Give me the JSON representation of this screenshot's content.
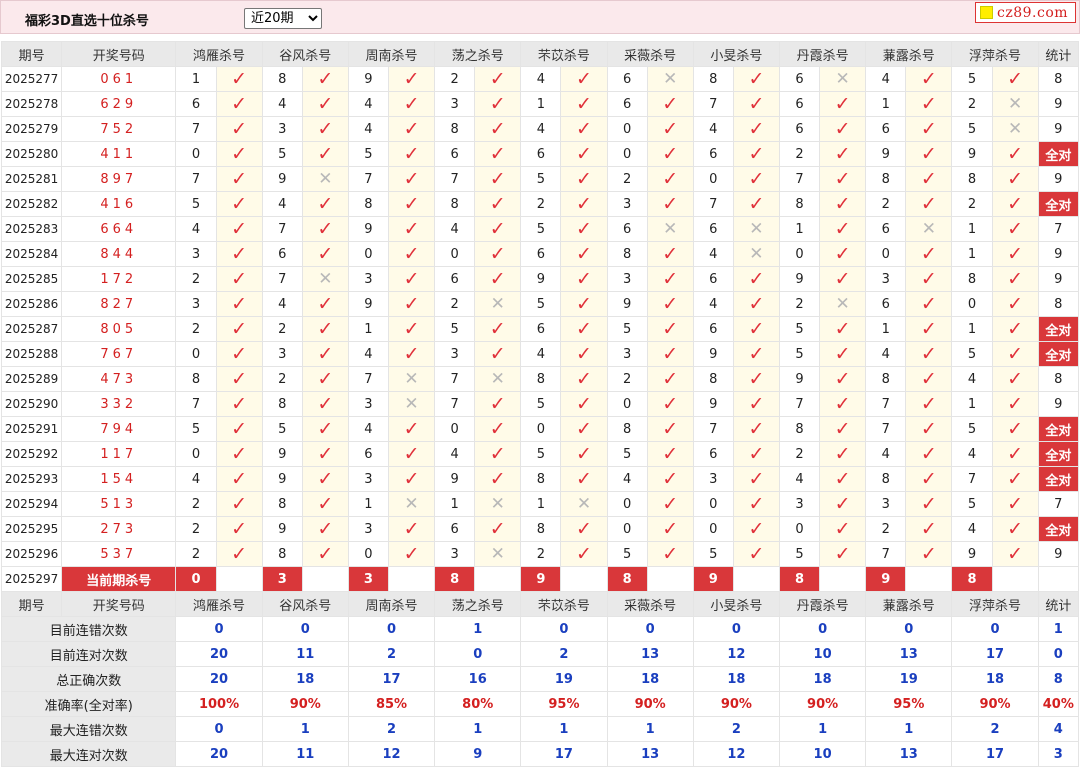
{
  "header": {
    "title": "福彩3D直选十位杀号",
    "period_select": "近20期",
    "logo_text": "cz89.com"
  },
  "columns": {
    "issue": "期号",
    "draw": "开奖号码",
    "experts": [
      "鸿雁杀号",
      "谷风杀号",
      "周南杀号",
      "荡之杀号",
      "芣苡杀号",
      "采薇杀号",
      "小旻杀号",
      "丹霞杀号",
      "蒹露杀号",
      "浮萍杀号"
    ],
    "stat": "统计"
  },
  "all_correct_label": "全对",
  "icons": {
    "hit": "check-mark-icon",
    "miss": "cross-mark-icon",
    "hit_color": "#e0303a",
    "miss_color": "#b8b8b8",
    "badge_color": "#d9373a"
  },
  "rows": [
    {
      "issue": "2025277",
      "draw": "061",
      "kills": [
        "1",
        "8",
        "9",
        "2",
        "4",
        "6",
        "8",
        "6",
        "4",
        "5"
      ],
      "hits": [
        1,
        1,
        1,
        1,
        1,
        0,
        1,
        0,
        1,
        1
      ],
      "stat": "8"
    },
    {
      "issue": "2025278",
      "draw": "629",
      "kills": [
        "6",
        "4",
        "4",
        "3",
        "1",
        "6",
        "7",
        "6",
        "1",
        "2"
      ],
      "hits": [
        1,
        1,
        1,
        1,
        1,
        1,
        1,
        1,
        1,
        0
      ],
      "stat": "9"
    },
    {
      "issue": "2025279",
      "draw": "752",
      "kills": [
        "7",
        "3",
        "4",
        "8",
        "4",
        "0",
        "4",
        "6",
        "6",
        "5"
      ],
      "hits": [
        1,
        1,
        1,
        1,
        1,
        1,
        1,
        1,
        1,
        0
      ],
      "stat": "9"
    },
    {
      "issue": "2025280",
      "draw": "411",
      "kills": [
        "0",
        "5",
        "5",
        "6",
        "6",
        "0",
        "6",
        "2",
        "9",
        "9"
      ],
      "hits": [
        1,
        1,
        1,
        1,
        1,
        1,
        1,
        1,
        1,
        1
      ],
      "stat": "全对"
    },
    {
      "issue": "2025281",
      "draw": "897",
      "kills": [
        "7",
        "9",
        "7",
        "7",
        "5",
        "2",
        "0",
        "7",
        "8",
        "8"
      ],
      "hits": [
        1,
        0,
        1,
        1,
        1,
        1,
        1,
        1,
        1,
        1
      ],
      "stat": "9"
    },
    {
      "issue": "2025282",
      "draw": "416",
      "kills": [
        "5",
        "4",
        "8",
        "8",
        "2",
        "3",
        "7",
        "8",
        "2",
        "2"
      ],
      "hits": [
        1,
        1,
        1,
        1,
        1,
        1,
        1,
        1,
        1,
        1
      ],
      "stat": "全对"
    },
    {
      "issue": "2025283",
      "draw": "664",
      "kills": [
        "4",
        "7",
        "9",
        "4",
        "5",
        "6",
        "6",
        "1",
        "6",
        "1"
      ],
      "hits": [
        1,
        1,
        1,
        1,
        1,
        0,
        0,
        1,
        0,
        1
      ],
      "stat": "7"
    },
    {
      "issue": "2025284",
      "draw": "844",
      "kills": [
        "3",
        "6",
        "0",
        "0",
        "6",
        "8",
        "4",
        "0",
        "0",
        "1"
      ],
      "hits": [
        1,
        1,
        1,
        1,
        1,
        1,
        0,
        1,
        1,
        1
      ],
      "stat": "9"
    },
    {
      "issue": "2025285",
      "draw": "172",
      "kills": [
        "2",
        "7",
        "3",
        "6",
        "9",
        "3",
        "6",
        "9",
        "3",
        "8"
      ],
      "hits": [
        1,
        0,
        1,
        1,
        1,
        1,
        1,
        1,
        1,
        1
      ],
      "stat": "9"
    },
    {
      "issue": "2025286",
      "draw": "827",
      "kills": [
        "3",
        "4",
        "9",
        "2",
        "5",
        "9",
        "4",
        "2",
        "6",
        "0"
      ],
      "hits": [
        1,
        1,
        1,
        0,
        1,
        1,
        1,
        0,
        1,
        1
      ],
      "stat": "8"
    },
    {
      "issue": "2025287",
      "draw": "805",
      "kills": [
        "2",
        "2",
        "1",
        "5",
        "6",
        "5",
        "6",
        "5",
        "1",
        "1"
      ],
      "hits": [
        1,
        1,
        1,
        1,
        1,
        1,
        1,
        1,
        1,
        1
      ],
      "stat": "全对"
    },
    {
      "issue": "2025288",
      "draw": "767",
      "kills": [
        "0",
        "3",
        "4",
        "3",
        "4",
        "3",
        "9",
        "5",
        "4",
        "5"
      ],
      "hits": [
        1,
        1,
        1,
        1,
        1,
        1,
        1,
        1,
        1,
        1
      ],
      "stat": "全对"
    },
    {
      "issue": "2025289",
      "draw": "473",
      "kills": [
        "8",
        "2",
        "7",
        "7",
        "8",
        "2",
        "8",
        "9",
        "8",
        "4"
      ],
      "hits": [
        1,
        1,
        0,
        0,
        1,
        1,
        1,
        1,
        1,
        1
      ],
      "stat": "8"
    },
    {
      "issue": "2025290",
      "draw": "332",
      "kills": [
        "7",
        "8",
        "3",
        "7",
        "5",
        "0",
        "9",
        "7",
        "7",
        "1"
      ],
      "hits": [
        1,
        1,
        0,
        1,
        1,
        1,
        1,
        1,
        1,
        1
      ],
      "stat": "9"
    },
    {
      "issue": "2025291",
      "draw": "794",
      "kills": [
        "5",
        "5",
        "4",
        "0",
        "0",
        "8",
        "7",
        "8",
        "7",
        "5"
      ],
      "hits": [
        1,
        1,
        1,
        1,
        1,
        1,
        1,
        1,
        1,
        1
      ],
      "stat": "全对"
    },
    {
      "issue": "2025292",
      "draw": "117",
      "kills": [
        "0",
        "9",
        "6",
        "4",
        "5",
        "5",
        "6",
        "2",
        "4",
        "4"
      ],
      "hits": [
        1,
        1,
        1,
        1,
        1,
        1,
        1,
        1,
        1,
        1
      ],
      "stat": "全对"
    },
    {
      "issue": "2025293",
      "draw": "154",
      "kills": [
        "4",
        "9",
        "3",
        "9",
        "8",
        "4",
        "3",
        "4",
        "8",
        "7"
      ],
      "hits": [
        1,
        1,
        1,
        1,
        1,
        1,
        1,
        1,
        1,
        1
      ],
      "stat": "全对"
    },
    {
      "issue": "2025294",
      "draw": "513",
      "kills": [
        "2",
        "8",
        "1",
        "1",
        "1",
        "0",
        "0",
        "3",
        "3",
        "5"
      ],
      "hits": [
        1,
        1,
        0,
        0,
        0,
        1,
        1,
        1,
        1,
        1
      ],
      "stat": "7"
    },
    {
      "issue": "2025295",
      "draw": "273",
      "kills": [
        "2",
        "9",
        "3",
        "6",
        "8",
        "0",
        "0",
        "0",
        "2",
        "4"
      ],
      "hits": [
        1,
        1,
        1,
        1,
        1,
        1,
        1,
        1,
        1,
        1
      ],
      "stat": "全对"
    },
    {
      "issue": "2025296",
      "draw": "537",
      "kills": [
        "2",
        "8",
        "0",
        "3",
        "2",
        "5",
        "5",
        "5",
        "7",
        "9"
      ],
      "hits": [
        1,
        1,
        1,
        0,
        1,
        1,
        1,
        1,
        1,
        1
      ],
      "stat": "9"
    }
  ],
  "current": {
    "issue": "2025297",
    "label": "当前期杀号",
    "kills": [
      "0",
      "3",
      "3",
      "8",
      "9",
      "8",
      "9",
      "8",
      "9",
      "8"
    ]
  },
  "summary": [
    {
      "label": "目前连错次数",
      "values": [
        "0",
        "0",
        "0",
        "1",
        "0",
        "0",
        "0",
        "0",
        "0",
        "0"
      ],
      "stat": "1",
      "style": "sum"
    },
    {
      "label": "目前连对次数",
      "values": [
        "20",
        "11",
        "2",
        "0",
        "2",
        "13",
        "12",
        "10",
        "13",
        "17"
      ],
      "stat": "0",
      "style": "sum"
    },
    {
      "label": "总正确次数",
      "values": [
        "20",
        "18",
        "17",
        "16",
        "19",
        "18",
        "18",
        "18",
        "19",
        "18"
      ],
      "stat": "8",
      "style": "sum"
    },
    {
      "label": "准确率(全对率)",
      "values": [
        "100%",
        "90%",
        "85%",
        "80%",
        "95%",
        "90%",
        "90%",
        "90%",
        "95%",
        "90%"
      ],
      "stat": "40%",
      "style": "pct"
    },
    {
      "label": "最大连错次数",
      "values": [
        "0",
        "1",
        "2",
        "1",
        "1",
        "1",
        "2",
        "1",
        "1",
        "2"
      ],
      "stat": "4",
      "style": "sum"
    },
    {
      "label": "最大连对次数",
      "values": [
        "20",
        "11",
        "12",
        "9",
        "17",
        "13",
        "12",
        "10",
        "13",
        "17"
      ],
      "stat": "3",
      "style": "sum"
    }
  ]
}
